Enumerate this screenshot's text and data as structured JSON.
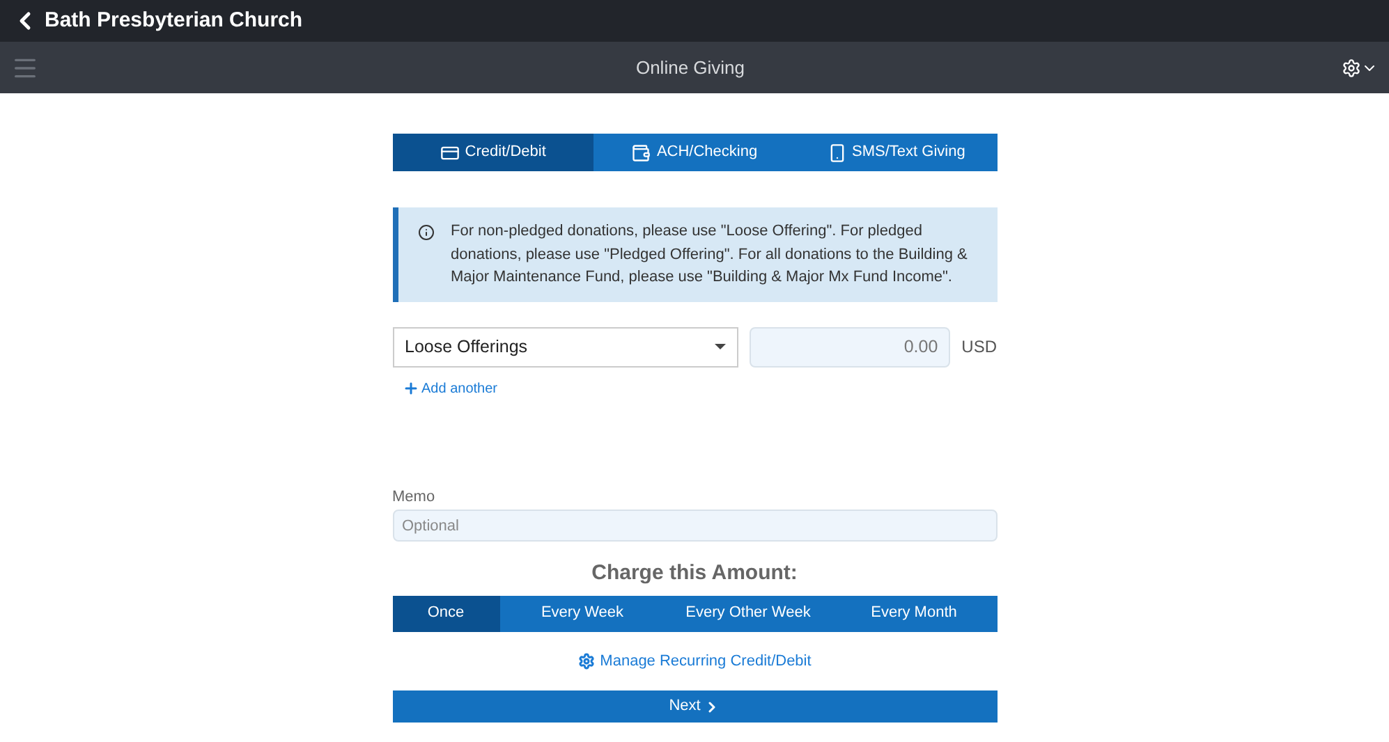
{
  "header": {
    "back_title": "Bath Presbyterian Church"
  },
  "toolbar": {
    "title": "Online Giving"
  },
  "payment_tabs": [
    {
      "label": "Credit/Debit",
      "kind": "card",
      "selected": true
    },
    {
      "label": "ACH/Checking",
      "kind": "check",
      "selected": false
    },
    {
      "label": "SMS/Text Giving",
      "kind": "phone",
      "selected": false
    }
  ],
  "notice": "For non-pledged donations, please use \"Loose Offering\". For pledged donations, please use \"Pledged Offering\". For all donations to the Building & Major Maintenance Fund, please use \"Building & Major Mx Fund Income\".",
  "fund": {
    "value": "Loose Offerings",
    "amount_placeholder": "0.00",
    "currency": "USD"
  },
  "add_another": "Add another",
  "memo": {
    "label": "Memo",
    "placeholder": "Optional"
  },
  "frequency": {
    "heading": "Charge this Amount:",
    "options": [
      {
        "label": "Once",
        "selected": true
      },
      {
        "label": "Every Week",
        "selected": false
      },
      {
        "label": "Every Other Week",
        "selected": false
      },
      {
        "label": "Every Month",
        "selected": false
      }
    ]
  },
  "manage_link": "Manage Recurring Credit/Debit",
  "next_button": "Next"
}
